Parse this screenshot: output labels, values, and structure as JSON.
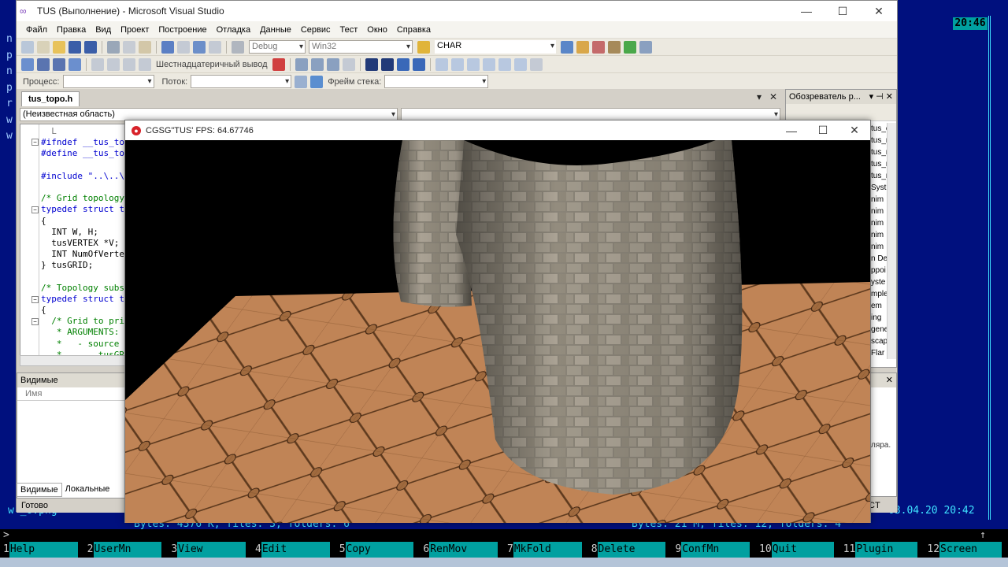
{
  "far": {
    "clock": "20:46",
    "left_chars": [
      "n",
      "p",
      "n",
      "p",
      "r",
      "w",
      "w"
    ],
    "left_file": "w  _o.png",
    "status_left": "Bytes: 4376 K, files: 3, folders: 6",
    "status_right": "Bytes: 21 M, files: 12, folders: 4",
    "date": "03.04.20 20:42",
    "prompt": ">",
    "arrow": "↑",
    "fkeys": [
      {
        "num": "1",
        "label": "Help"
      },
      {
        "num": "2",
        "label": "UserMn"
      },
      {
        "num": "3",
        "label": "View"
      },
      {
        "num": "4",
        "label": "Edit"
      },
      {
        "num": "5",
        "label": "Copy"
      },
      {
        "num": "6",
        "label": "RenMov"
      },
      {
        "num": "7",
        "label": "MkFold"
      },
      {
        "num": "8",
        "label": "Delete"
      },
      {
        "num": "9",
        "label": "ConfMn"
      },
      {
        "num": "10",
        "label": "Quit"
      },
      {
        "num": "11",
        "label": "Plugin"
      },
      {
        "num": "12",
        "label": "Screen"
      }
    ]
  },
  "vs": {
    "title": "TUS (Выполнение) - Microsoft Visual Studio",
    "menu": [
      "Файл",
      "Правка",
      "Вид",
      "Проект",
      "Построение",
      "Отладка",
      "Данные",
      "Сервис",
      "Тест",
      "Окно",
      "Справка"
    ],
    "toolbar1": {
      "config": "Debug",
      "platform": "Win32",
      "find": "CHAR"
    },
    "toolbar2": {
      "hex_label": "Шестнадцатеричный вывод"
    },
    "toolbar3": {
      "process_label": "Процесс:",
      "thread_label": "Поток:",
      "frame_label": "Фрейм стека:"
    },
    "doc_tab": "tus_topo.h",
    "nav_scope": "(Неизвестная область)",
    "code_lines": [
      {
        "cls": "mg",
        "text": "  L"
      },
      {
        "cls": "kw",
        "text": "#ifndef __tus_topo_h_"
      },
      {
        "cls": "kw",
        "text": "#define __tus_topo_h_"
      },
      {
        "cls": "tx",
        "text": ""
      },
      {
        "cls": "kw",
        "text": "#include \"..\\..\\def.h\""
      },
      {
        "cls": "tx",
        "text": ""
      },
      {
        "cls": "cm",
        "text": "/* Grid topology"
      },
      {
        "cls": "kw",
        "text": "typedef struct tagtusGRID"
      },
      {
        "cls": "tx",
        "text": "{"
      },
      {
        "cls": "tx",
        "text": "  INT W, H;"
      },
      {
        "cls": "tx",
        "text": "  tusVERTEX *V;"
      },
      {
        "cls": "tx",
        "text": "  INT NumOfVertexes;"
      },
      {
        "cls": "tx",
        "text": "} tusGRID;"
      },
      {
        "cls": "tx",
        "text": ""
      },
      {
        "cls": "cm",
        "text": "/* Topology subsystem"
      },
      {
        "cls": "kw",
        "text": "typedef struct tagtusTOPO"
      },
      {
        "cls": "tx",
        "text": "{"
      },
      {
        "cls": "cm",
        "text": "  /* Grid to primitive"
      },
      {
        "cls": "cm",
        "text": "   * ARGUMENTS:"
      },
      {
        "cls": "cm",
        "text": "   *   - source grid"
      },
      {
        "cls": "cm",
        "text": "   *       tusGRID"
      }
    ],
    "locals_title": "Видимые",
    "locals_col": "Имя",
    "bottom_tab1": "Видимые",
    "bottom_tab2": "Локальные",
    "status": "Готово",
    "sol_title": "Обозреватель р...",
    "sol_items": [
      "tus_c",
      "tus_re",
      "tus_re",
      "tus_rr",
      "tus_rr",
      "Syst",
      "nim",
      "nim",
      "nim",
      "nim",
      "nim",
      "n De",
      "ppoi",
      "yste",
      "mple",
      "em",
      "ing",
      "gene",
      "scap",
      "Flar"
    ],
    "props_text": "ляра.",
    "props_ct": "CT"
  },
  "gl": {
    "title": "CGSG\"TUS' FPS: 64.67746"
  }
}
